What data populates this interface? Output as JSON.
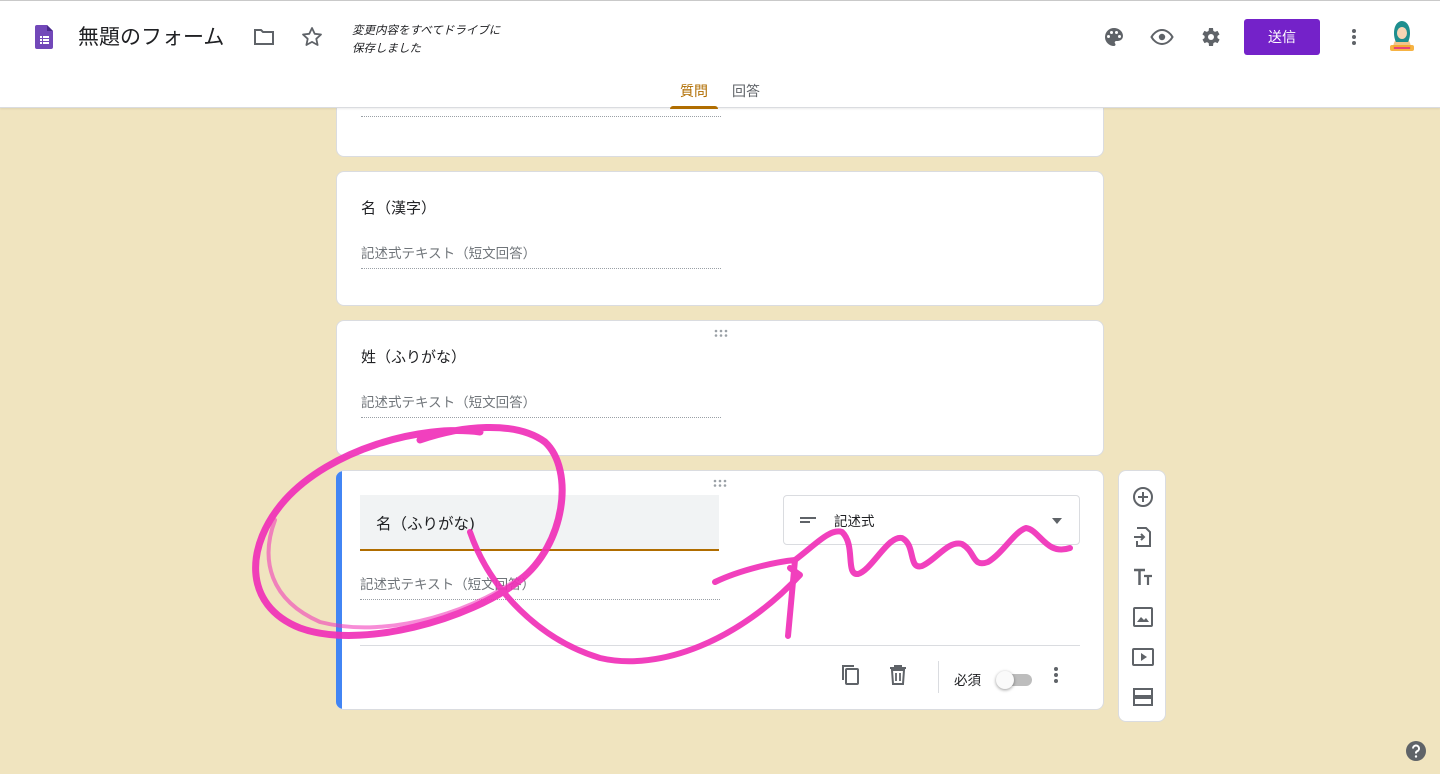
{
  "header": {
    "title": "無題のフォーム",
    "save_status_line1": "変更内容をすべてドライブに",
    "save_status_line2": "保存しました",
    "send_label": "送信",
    "icons": [
      "forms-logo-icon",
      "folder-icon",
      "star-icon",
      "palette-icon",
      "preview-eye-icon",
      "settings-gear-icon",
      "more-vert-icon",
      "avatar"
    ],
    "tabs": [
      {
        "label": "質問",
        "active": true
      },
      {
        "label": "回答",
        "active": false
      }
    ]
  },
  "questions": [
    {
      "title": "",
      "answer_placeholder": ""
    },
    {
      "title": "名（漢字）",
      "answer_placeholder": "記述式テキスト（短文回答）"
    },
    {
      "title": "姓（ふりがな）",
      "answer_placeholder": "記述式テキスト（短文回答）"
    }
  ],
  "active_question": {
    "title": "名（ふりがな)",
    "answer_placeholder": "記述式テキスト（短文回答）",
    "type_label": "記述式",
    "required_label": "必須",
    "required": false
  },
  "colors": {
    "accent": "#7422c9",
    "tab_active": "#b06d00",
    "background": "#f0e4bf",
    "active_bar": "#4285f4",
    "annotation": "#f030b8"
  },
  "side_toolbar": [
    "add-question-icon",
    "import-questions-icon",
    "add-title-icon",
    "add-image-icon",
    "add-video-icon",
    "add-section-icon"
  ]
}
